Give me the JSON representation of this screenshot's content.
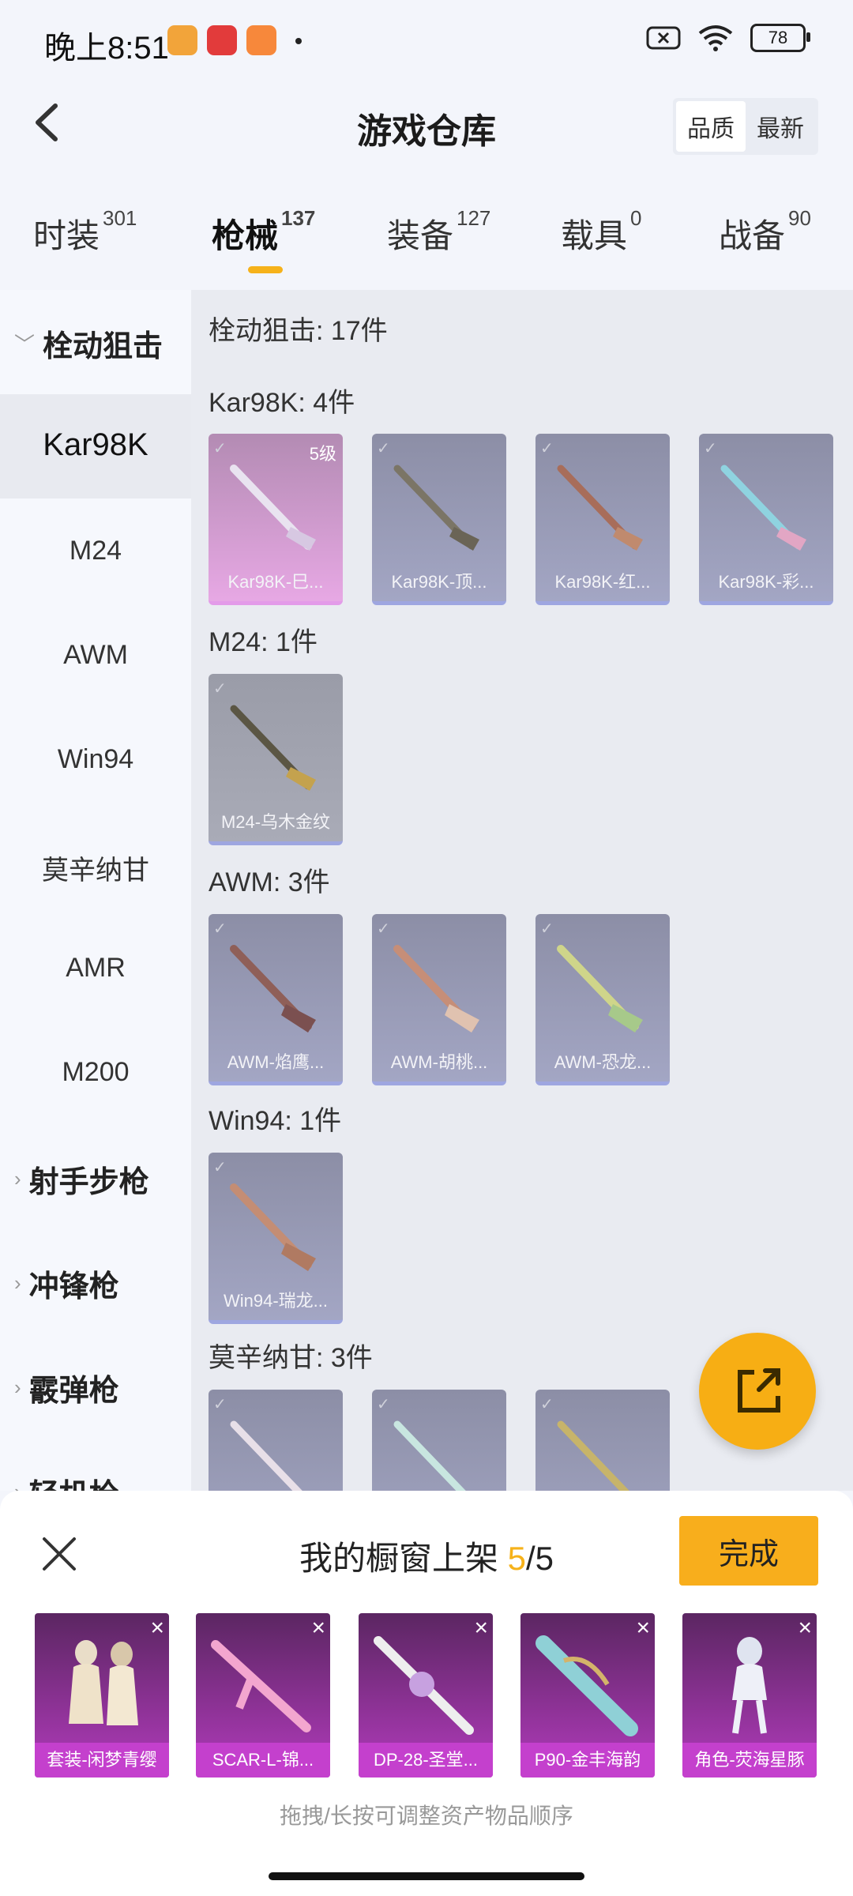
{
  "status": {
    "time": "晚上8:51",
    "battery": "78"
  },
  "header": {
    "title": "游戏仓库",
    "sort_options": [
      "品质",
      "最新"
    ],
    "sort_active": "品质"
  },
  "tabs": [
    {
      "label": "时装",
      "count": "301"
    },
    {
      "label": "枪械",
      "count": "137"
    },
    {
      "label": "装备",
      "count": "127"
    },
    {
      "label": "载具",
      "count": "0"
    },
    {
      "label": "战备",
      "count": "90"
    }
  ],
  "sidebar": {
    "group_open": "栓动狙击",
    "items": [
      "Kar98K",
      "M24",
      "AWM",
      "Win94",
      "莫辛纳甘",
      "AMR",
      "M200"
    ],
    "groups_closed": [
      "射手步枪",
      "冲锋枪",
      "霰弹枪",
      "轻机枪"
    ]
  },
  "content": {
    "header": "栓动狙击: 17件",
    "sections": [
      {
        "title": "Kar98K: 4件",
        "items": [
          {
            "name": "Kar98K-巳...",
            "level": "5级"
          },
          {
            "name": "Kar98K-顶..."
          },
          {
            "name": "Kar98K-红..."
          },
          {
            "name": "Kar98K-彩..."
          }
        ]
      },
      {
        "title": "M24: 1件",
        "items": [
          {
            "name": "M24-乌木金纹"
          }
        ]
      },
      {
        "title": "AWM: 3件",
        "items": [
          {
            "name": "AWM-焰鹰..."
          },
          {
            "name": "AWM-胡桃..."
          },
          {
            "name": "AWM-恐龙..."
          }
        ]
      },
      {
        "title": "Win94: 1件",
        "items": [
          {
            "name": "Win94-瑞龙..."
          }
        ]
      },
      {
        "title": "莫辛纳甘: 3件",
        "items": [
          {
            "name": ""
          },
          {
            "name": ""
          },
          {
            "name": ""
          }
        ]
      }
    ]
  },
  "sheet": {
    "title_prefix": "我的橱窗上架",
    "count": "5",
    "total": "/5",
    "done": "完成",
    "items": [
      "套装-闲梦青缨",
      "SCAR-L-锦...",
      "DP-28-圣堂...",
      "P90-金丰海韵",
      "角色-荧海星豚"
    ],
    "hint": "拖拽/长按可调整资产物品顺序"
  },
  "colors": {
    "accent": "#f6b21a",
    "shelf_purple": "#c440cd"
  }
}
